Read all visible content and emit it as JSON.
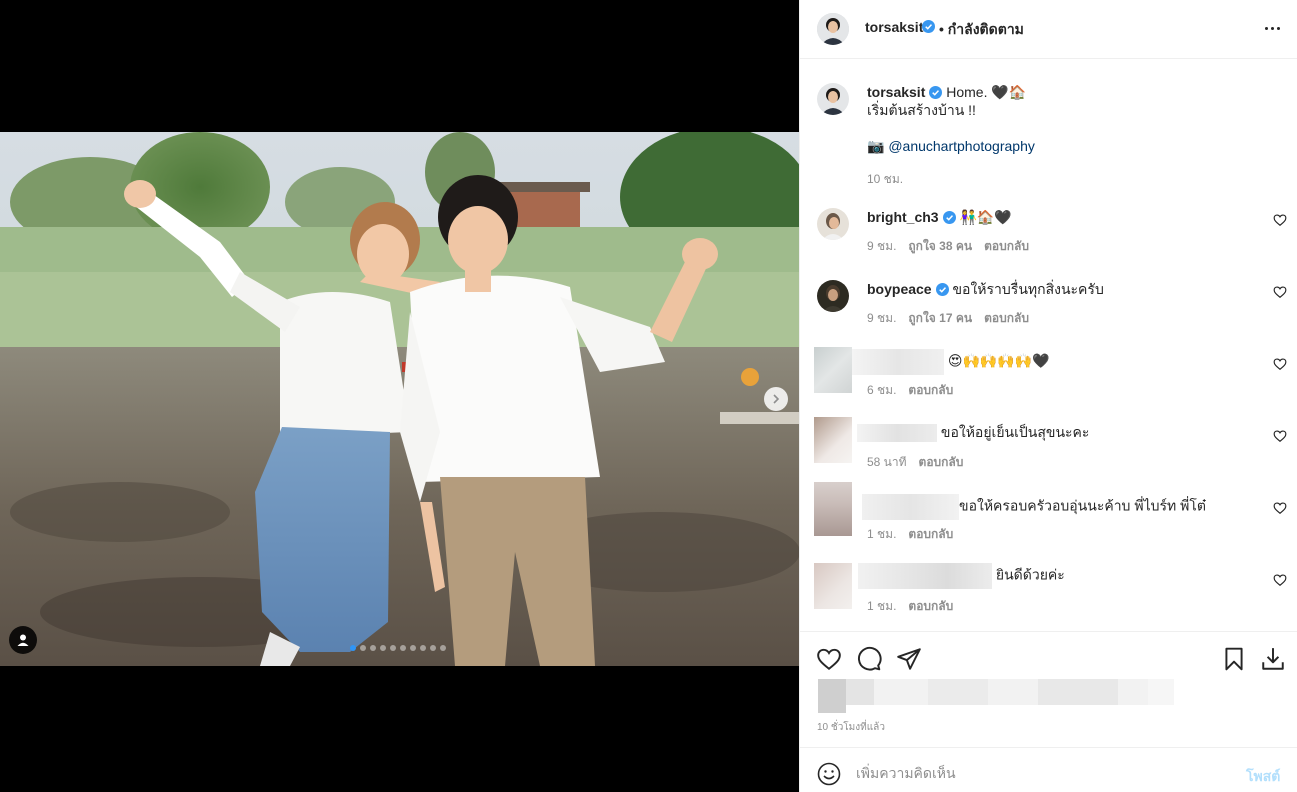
{
  "header": {
    "username": "torsaksit",
    "separator": "•",
    "follow_label": "กำลังติดตาม",
    "more_icon": "more-horizontal-icon"
  },
  "caption": {
    "username": "torsaksit",
    "line1": "Home. 🖤🏠",
    "line2": "เริ่มต้นสร้างบ้าน !!",
    "camera": "📷",
    "mention": "@anuchartphotography",
    "time": "10 ชม."
  },
  "comments": [
    {
      "username": "bright_ch3",
      "verified": true,
      "text": "👫🏠🖤",
      "time": "9 ชม.",
      "likes": "ถูกใจ 38 คน",
      "reply": "ตอบกลับ"
    },
    {
      "username": "boypeace",
      "verified": true,
      "text": "ขอให้ราบรื่นทุกสิ่งนะครับ",
      "time": "9 ชม.",
      "likes": "ถูกใจ 17 คน",
      "reply": "ตอบกลับ"
    },
    {
      "text": "😍🙌🙌🙌🙌🖤",
      "time": "6 ชม.",
      "reply": "ตอบกลับ"
    },
    {
      "text": "ขอให้อยู่เย็นเป็นสุขนะคะ",
      "time": "58 นาที",
      "reply": "ตอบกลับ"
    },
    {
      "text": "ขอให้ครอบครัวอบอุ่นนะค้าบ พี่ไบร์ท พี่โต๋",
      "time": "1 ชม.",
      "reply": "ตอบกลับ"
    },
    {
      "text": "ยินดีด้วยค่ะ",
      "time": "1 ชม.",
      "reply": "ตอบกลับ"
    }
  ],
  "actions": {
    "time_ago": "10 ชั่วโมงที่แล้ว"
  },
  "add_comment": {
    "placeholder": "เพิ่มความคิดเห็น",
    "post_label": "โพสต์"
  },
  "carousel": {
    "count": 10,
    "active_index": 0
  },
  "colors": {
    "verified": "#3897f0",
    "link": "#00376b",
    "muted": "#8e8e8e",
    "post_disabled": "#b2dffc",
    "active_dot": "#2f95f6"
  }
}
